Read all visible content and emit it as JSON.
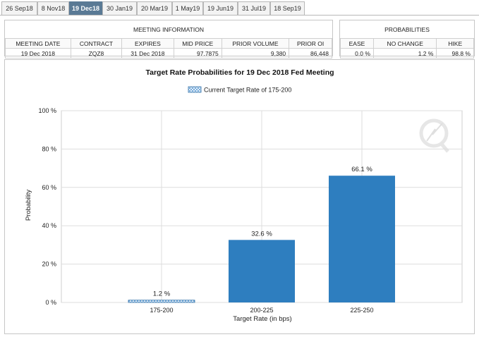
{
  "tabs": [
    {
      "label": "26 Sep18",
      "active": false
    },
    {
      "label": "8 Nov18",
      "active": false
    },
    {
      "label": "19 Dec18",
      "active": true
    },
    {
      "label": "30 Jan19",
      "active": false
    },
    {
      "label": "20 Mar19",
      "active": false
    },
    {
      "label": "1 May19",
      "active": false
    },
    {
      "label": "19 Jun19",
      "active": false
    },
    {
      "label": "31 Jul19",
      "active": false
    },
    {
      "label": "18 Sep19",
      "active": false
    }
  ],
  "meeting_info": {
    "title": "MEETING INFORMATION",
    "headers": [
      "MEETING DATE",
      "CONTRACT",
      "EXPIRES",
      "MID PRICE",
      "PRIOR VOLUME",
      "PRIOR OI"
    ],
    "values": [
      "19 Dec 2018",
      "ZQZ8",
      "31 Dec 2018",
      "97.7875",
      "9,380",
      "86,448"
    ]
  },
  "probabilities": {
    "title": "PROBABILITIES",
    "headers": [
      "EASE",
      "NO CHANGE",
      "HIKE"
    ],
    "values": [
      "0.0 %",
      "1.2 %",
      "98.8 %"
    ]
  },
  "colors": {
    "bar": "#2e7ebf",
    "current_bar": "#5b9bd5",
    "tab_active": "#5a7a95",
    "grid": "#dddddd"
  },
  "chart_data": {
    "type": "bar",
    "title": "Target Rate Probabilities for 19 Dec 2018 Fed Meeting",
    "legend": "Current Target Rate of 175-200",
    "legend_position": "top-center",
    "categories": [
      "175-200",
      "200-225",
      "225-250"
    ],
    "values": [
      1.2,
      32.6,
      66.1
    ],
    "data_labels": [
      "1.2 %",
      "32.6 %",
      "66.1 %"
    ],
    "current_index": 0,
    "xlabel": "Target Rate (in bps)",
    "ylabel": "Probability",
    "ylim": [
      0,
      100
    ],
    "yticks": [
      0,
      20,
      40,
      60,
      80,
      100
    ],
    "ytick_labels": [
      "0 %",
      "20 %",
      "40 %",
      "60 %",
      "80 %",
      "100 %"
    ],
    "grid": true,
    "watermark_icon": "cme-q-logo-icon"
  }
}
